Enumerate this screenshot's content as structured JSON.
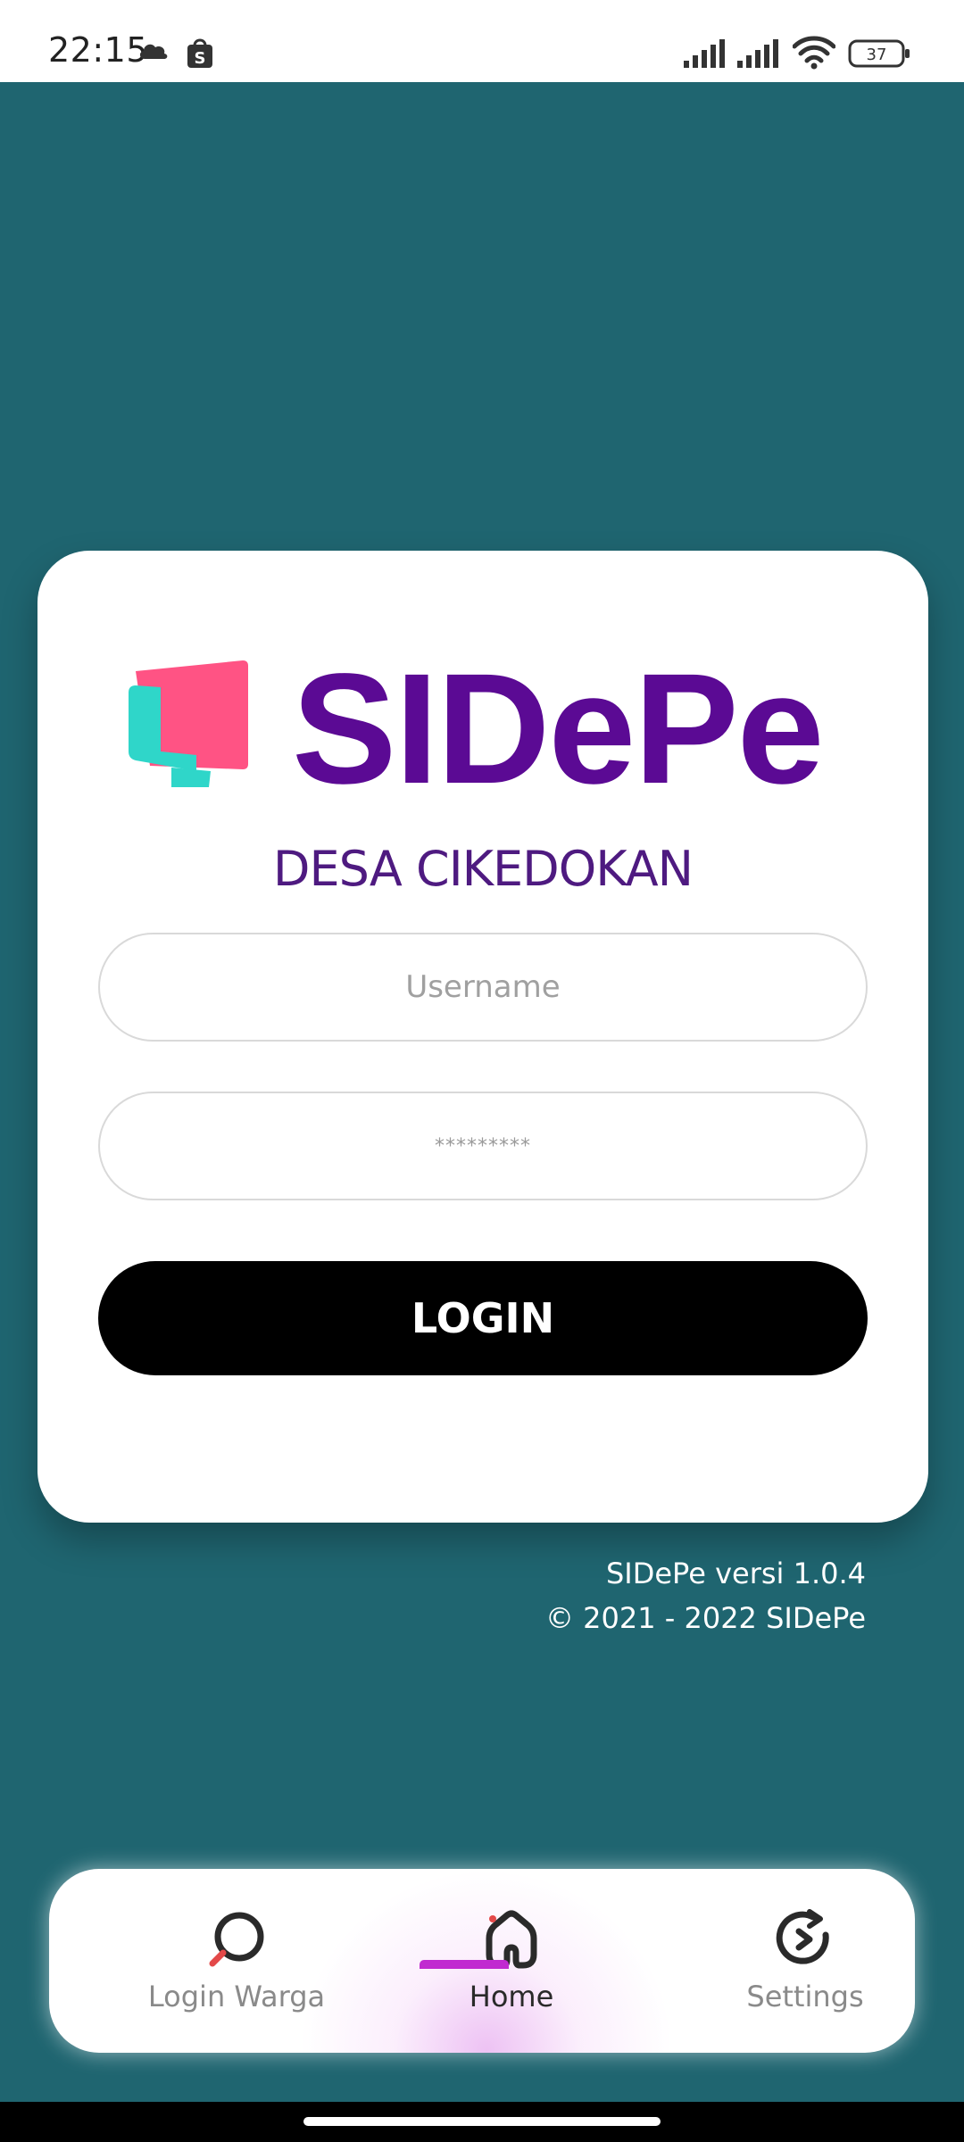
{
  "status_bar": {
    "time": "22:15",
    "icons": [
      "cloud-icon",
      "shopee-icon",
      "signal-icon",
      "signal-icon",
      "wifi-icon",
      "battery-icon"
    ],
    "battery_level": "37"
  },
  "card": {
    "logo_text": "SIDePe",
    "village_name": "DESA CIKEDOKAN",
    "username_placeholder": "Username",
    "password_value": "*********",
    "login_label": "LOGIN"
  },
  "footer": {
    "version": "SIDePe versi 1.0.4",
    "copyright": "© 2021 - 2022 SIDePe"
  },
  "bottom_nav": {
    "items": [
      {
        "label": "Login Warga",
        "icon": "search-icon"
      },
      {
        "label": "Home",
        "icon": "home-icon",
        "active": true
      },
      {
        "label": "Settings",
        "icon": "settings-icon"
      }
    ]
  },
  "colors": {
    "background": "#1f6570",
    "brand_purple": "#5b0a94",
    "logo_pink": "#ff5384",
    "logo_teal": "#2fd6c9",
    "active_indicator": "#c12ad0"
  }
}
